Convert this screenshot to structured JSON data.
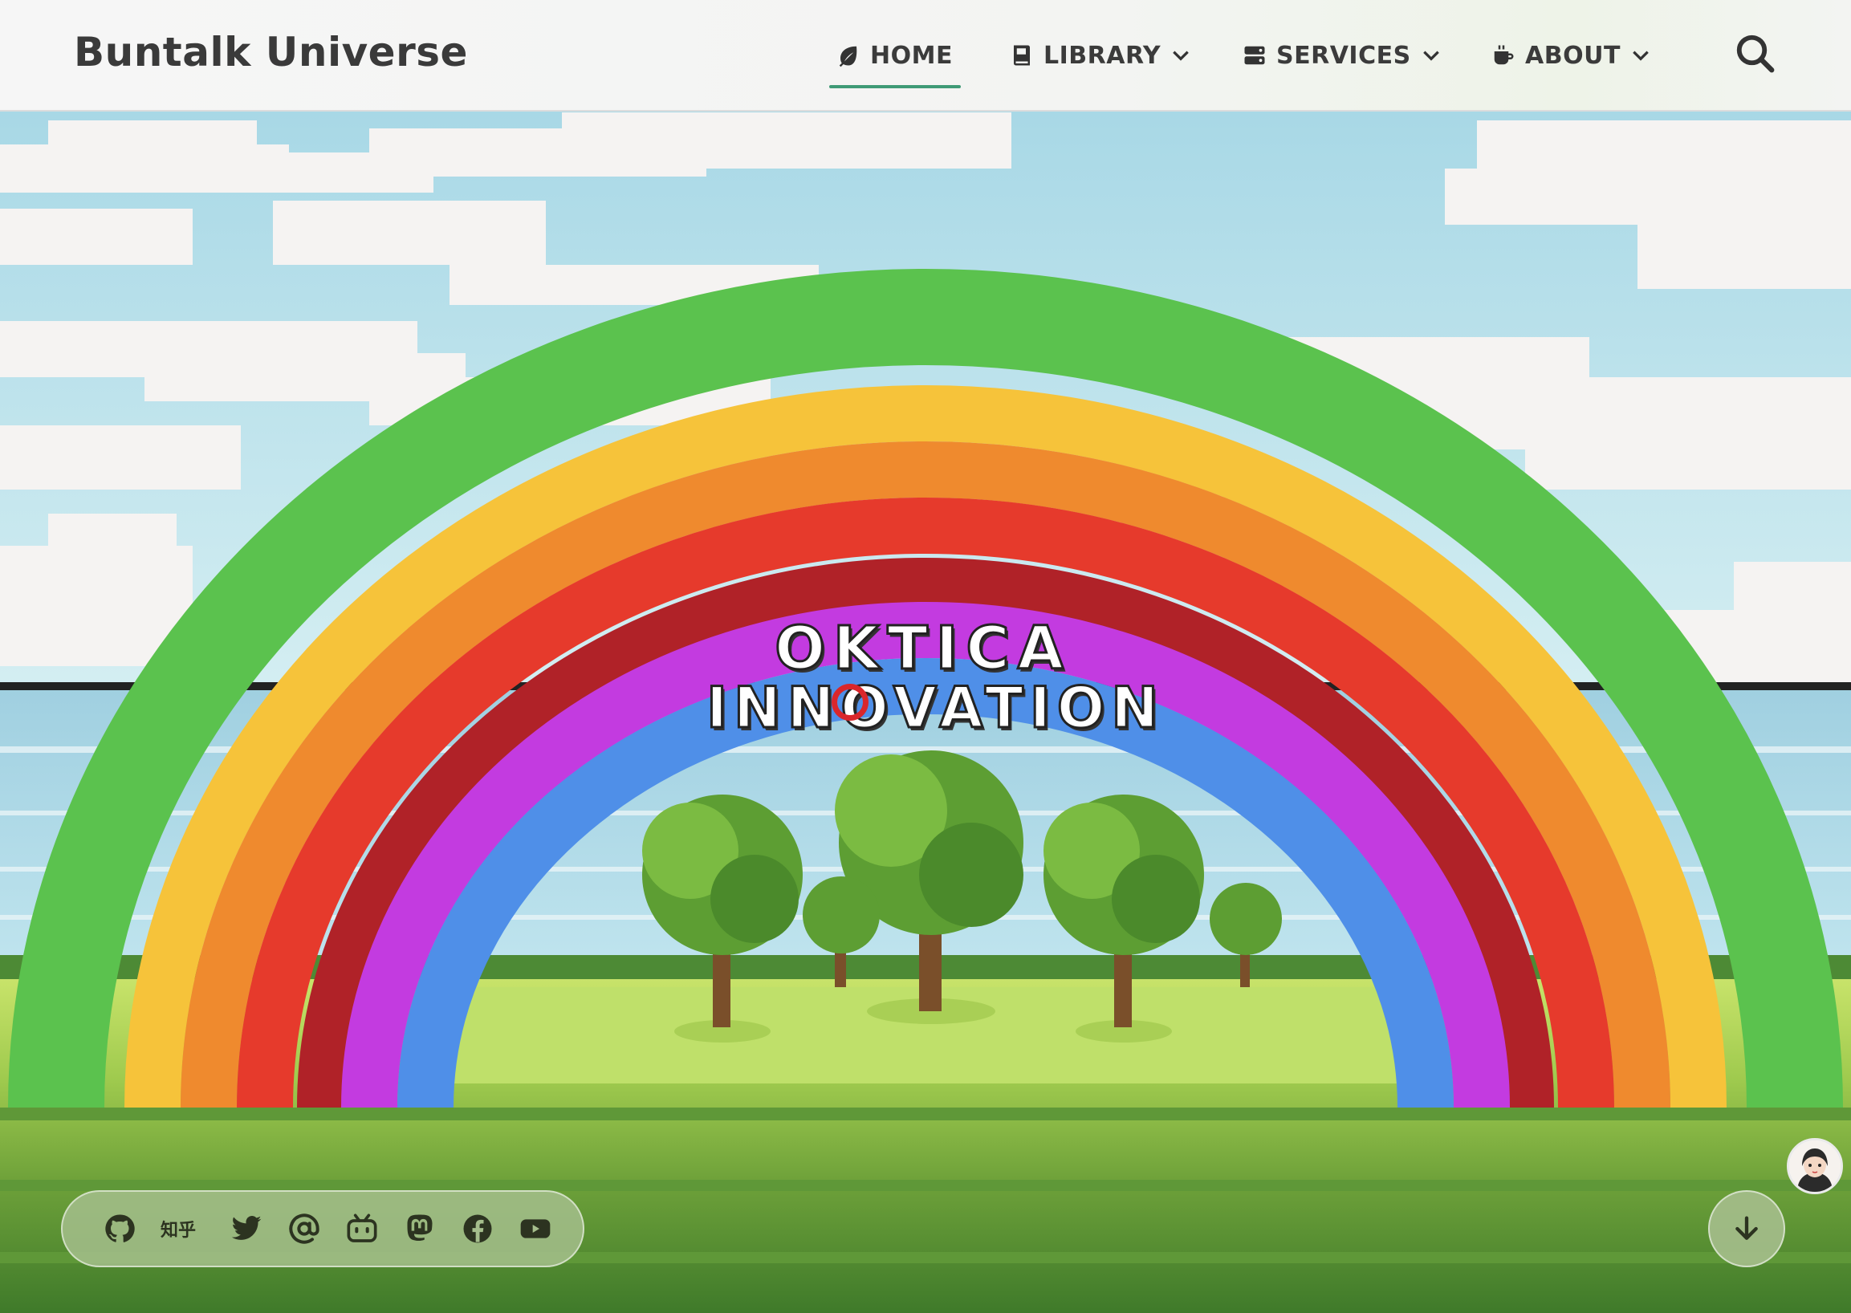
{
  "header": {
    "brand": "Buntalk Universe",
    "nav": [
      {
        "label": "HOME",
        "icon": "leaf-icon",
        "active": true,
        "has_dropdown": false
      },
      {
        "label": "LIBRARY",
        "icon": "book-icon",
        "active": false,
        "has_dropdown": true
      },
      {
        "label": "SERVICES",
        "icon": "server-icon",
        "active": false,
        "has_dropdown": true
      },
      {
        "label": "ABOUT",
        "icon": "coffee-icon",
        "active": false,
        "has_dropdown": true
      }
    ],
    "search_icon": "search-icon",
    "accent_color": "#3f9a76"
  },
  "hero": {
    "logo_line1": "OKTICA",
    "logo_line2": "INNOVATION",
    "logo_accent_color": "#d9262b"
  },
  "social": {
    "items": [
      {
        "name": "github",
        "icon": "github-icon"
      },
      {
        "name": "zhihu",
        "label": "知乎"
      },
      {
        "name": "twitter",
        "icon": "twitter-icon"
      },
      {
        "name": "email",
        "icon": "at-icon"
      },
      {
        "name": "bilibili",
        "icon": "bilibili-icon"
      },
      {
        "name": "mastodon",
        "icon": "mastodon-icon"
      },
      {
        "name": "facebook",
        "icon": "facebook-icon"
      },
      {
        "name": "youtube",
        "icon": "youtube-icon"
      }
    ]
  },
  "scroll_down_icon": "arrow-down-icon",
  "avatar_icon": "avatar"
}
